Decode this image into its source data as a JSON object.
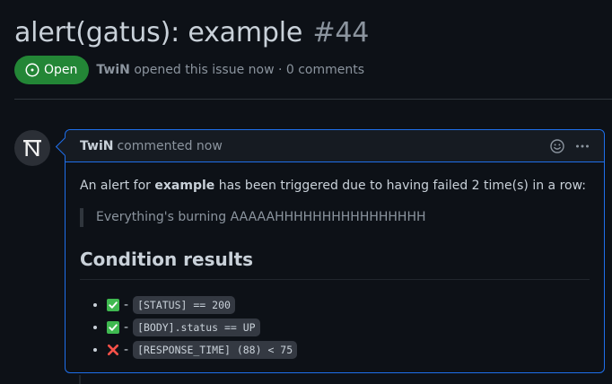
{
  "issue": {
    "title": "alert(gatus): example",
    "number": "#44",
    "state": "Open",
    "author": "TwiN",
    "meta_text": "opened this issue now · 0 comments"
  },
  "comment": {
    "author": "TwiN",
    "time_text": "commented now",
    "intro_prefix": "An alert for ",
    "intro_bold": "example",
    "intro_suffix": " has been triggered due to having failed 2 time(s) in a row:",
    "quote": "Everything's burning AAAAAHHHHHHHHHHHHHHHH",
    "heading": "Condition results",
    "conditions": [
      {
        "status": "success",
        "icon": "check-mark-icon",
        "separator": "-",
        "code": "[STATUS] == 200"
      },
      {
        "status": "success",
        "icon": "check-mark-icon",
        "separator": "-",
        "code": "[BODY].status == UP"
      },
      {
        "status": "failure",
        "icon": "cross-mark-icon",
        "separator": "-",
        "code": "[RESPONSE_TIME] (88) < 75"
      }
    ]
  },
  "colors": {
    "background": "#0d1117",
    "open_badge": "#238636",
    "comment_border": "#1f6feb",
    "success": "#3fb950",
    "failure": "#f85149"
  }
}
